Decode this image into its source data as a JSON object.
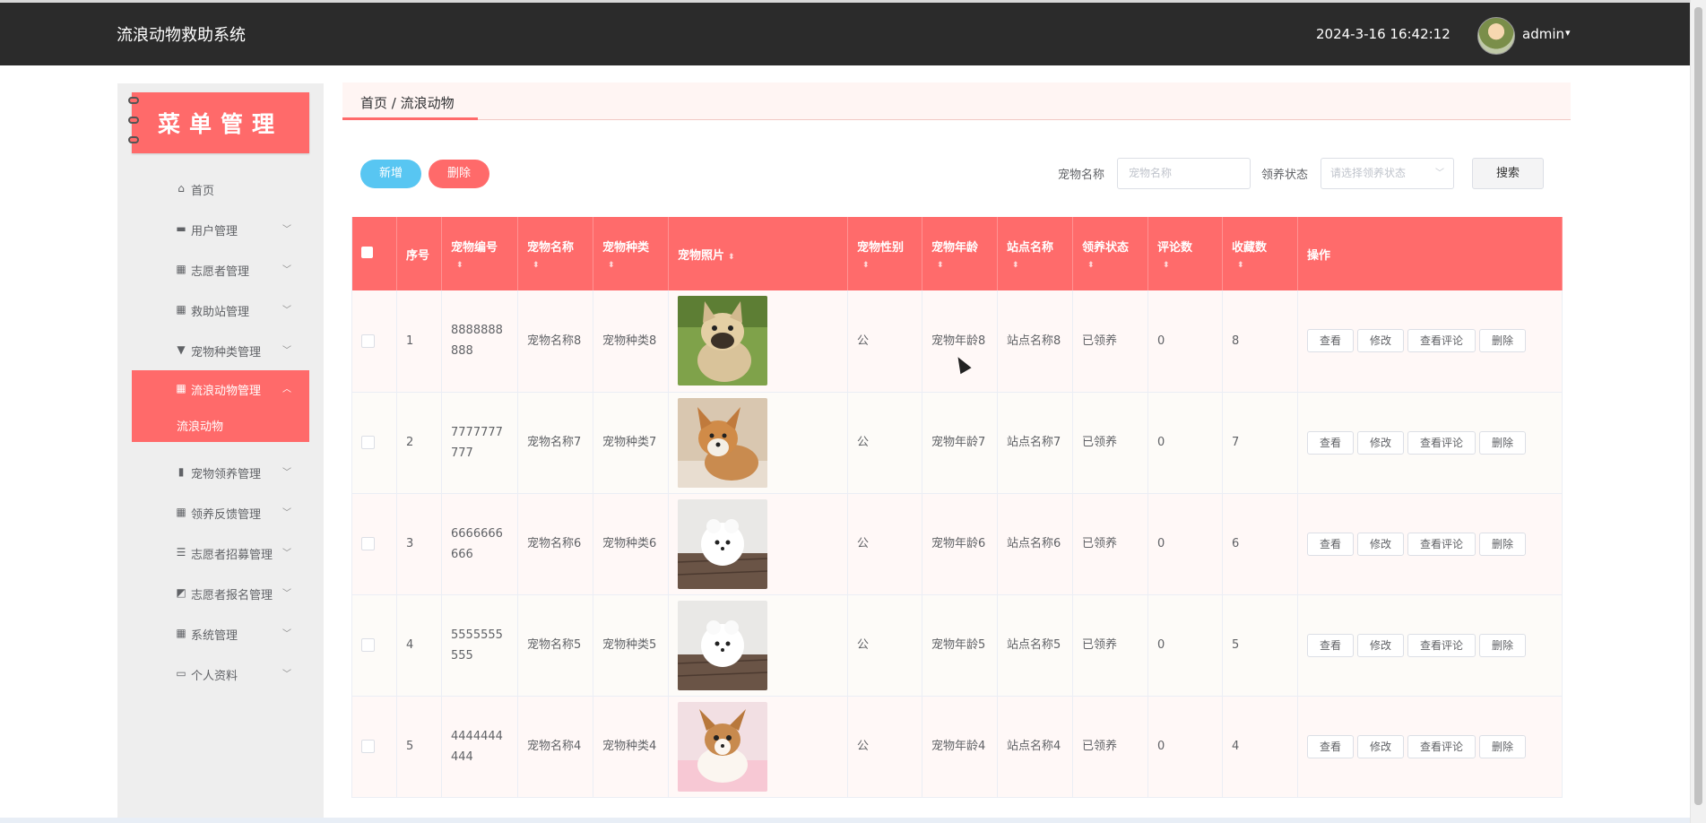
{
  "header": {
    "title": "流浪动物救助系统",
    "datetime": "2024-3-16 16:42:12",
    "user": "admin",
    "caret": "▾"
  },
  "sidebar": {
    "banner": "菜单管理",
    "items": [
      {
        "label": "首页",
        "icon": "⌂",
        "has_children": false
      },
      {
        "label": "用户管理",
        "icon": "▬",
        "has_children": true
      },
      {
        "label": "志愿者管理",
        "icon": "▦",
        "has_children": true
      },
      {
        "label": "救助站管理",
        "icon": "▦",
        "has_children": true
      },
      {
        "label": "宠物种类管理",
        "icon": "▼",
        "has_children": true
      },
      {
        "label": "流浪动物管理",
        "icon": "▦",
        "has_children": true,
        "active": true
      },
      {
        "label": "宠物领养管理",
        "icon": "▮",
        "has_children": true
      },
      {
        "label": "领养反馈管理",
        "icon": "▦",
        "has_children": true
      },
      {
        "label": "志愿者招募管理",
        "icon": "☰",
        "has_children": true
      },
      {
        "label": "志愿者报名管理",
        "icon": "◩",
        "has_children": true
      },
      {
        "label": "系统管理",
        "icon": "▦",
        "has_children": true
      },
      {
        "label": "个人资料",
        "icon": "▭",
        "has_children": true
      }
    ],
    "active_submenu": "流浪动物"
  },
  "breadcrumb": "首页 / 流浪动物",
  "toolbar": {
    "add_label": "新增",
    "delete_label": "删除",
    "name_label": "宠物名称",
    "name_placeholder": "宠物名称",
    "status_label": "领养状态",
    "status_placeholder": "请选择领养状态",
    "search_label": "搜索"
  },
  "table": {
    "columns": [
      "序号",
      "宠物编号",
      "宠物名称",
      "宠物种类",
      "宠物照片",
      "宠物性别",
      "宠物年龄",
      "站点名称",
      "领养状态",
      "评论数",
      "收藏数",
      "操作"
    ],
    "row_actions": [
      "查看",
      "修改",
      "查看评论",
      "删除"
    ],
    "rows": [
      {
        "index": "1",
        "code": "8888888888",
        "name": "宠物名称8",
        "kind": "宠物种类8",
        "photo": "french-bulldog",
        "gender": "公",
        "age": "宠物年龄8",
        "station": "站点名称8",
        "status": "已领养",
        "comments": "0",
        "favorites": "8"
      },
      {
        "index": "2",
        "code": "7777777777",
        "name": "宠物名称7",
        "kind": "宠物种类7",
        "photo": "corgi-puppy",
        "gender": "公",
        "age": "宠物年龄7",
        "station": "站点名称7",
        "status": "已领养",
        "comments": "0",
        "favorites": "7"
      },
      {
        "index": "3",
        "code": "6666666666",
        "name": "宠物名称6",
        "kind": "宠物种类6",
        "photo": "white-pomeranian",
        "gender": "公",
        "age": "宠物年龄6",
        "station": "站点名称6",
        "status": "已领养",
        "comments": "0",
        "favorites": "6"
      },
      {
        "index": "4",
        "code": "5555555555",
        "name": "宠物名称5",
        "kind": "宠物种类5",
        "photo": "white-pomeranian",
        "gender": "公",
        "age": "宠物年龄5",
        "station": "站点名称5",
        "status": "已领养",
        "comments": "0",
        "favorites": "5"
      },
      {
        "index": "5",
        "code": "4444444444",
        "name": "宠物名称4",
        "kind": "宠物种类4",
        "photo": "chihuahua-puppy",
        "gender": "公",
        "age": "宠物年龄4",
        "station": "站点名称4",
        "status": "已领养",
        "comments": "0",
        "favorites": "4"
      }
    ]
  },
  "colors": {
    "accent": "#ff6a6a",
    "add_button": "#58c6f2",
    "topbar": "#2b2b2b"
  }
}
